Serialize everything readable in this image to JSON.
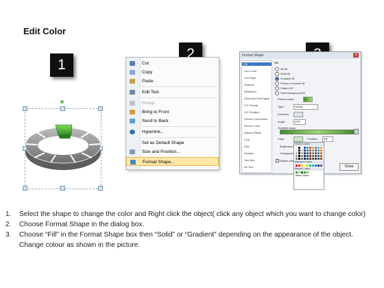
{
  "header": {
    "title": "Edit Color"
  },
  "step_badges": [
    "1",
    "2",
    "3"
  ],
  "context_menu": {
    "items": [
      {
        "label": "Cut",
        "icon": "scissors-icon",
        "disabled": false
      },
      {
        "label": "Copy",
        "icon": "copy-icon",
        "disabled": false
      },
      {
        "label": "Paste",
        "icon": "paste-icon",
        "disabled": false
      },
      {
        "label": "Edit Text",
        "icon": "edit-text-icon",
        "disabled": false
      },
      {
        "label": "Group",
        "icon": "group-icon",
        "disabled": true
      },
      {
        "label": "Bring to Front",
        "icon": "bring-to-front-icon",
        "disabled": false
      },
      {
        "label": "Send to Back",
        "icon": "send-to-back-icon",
        "disabled": false
      },
      {
        "label": "Hyperlink...",
        "icon": "hyperlink-icon",
        "disabled": false
      },
      {
        "label": "Set as Default Shape",
        "icon": "none",
        "disabled": false
      },
      {
        "label": "Size and Position...",
        "icon": "size-position-icon",
        "disabled": false
      },
      {
        "label": "Format Shape...",
        "icon": "format-shape-icon",
        "disabled": false,
        "highlighted": true
      }
    ]
  },
  "format_dialog": {
    "title": "Format Shape",
    "categories": [
      "Fill",
      "Line Color",
      "Line Style",
      "Shadow",
      "Reflection",
      "Glow and Soft Edges",
      "3-D Format",
      "3-D Rotation",
      "Picture Corrections",
      "Picture Color",
      "Artistic Effects",
      "Crop",
      "Size",
      "Position",
      "Text Box",
      "Alt Text"
    ],
    "section": "Fill",
    "fill_options": [
      "No fill",
      "Solid fill",
      "Gradient fill",
      "Picture or texture fill",
      "Pattern fill",
      "Slide background fill"
    ],
    "selected_fill": "Gradient fill",
    "preset_colors_label": "Preset colors:",
    "type_label": "Type:",
    "type_value": "Linear",
    "direction_label": "Direction:",
    "angle_label": "Angle:",
    "angle_value": "270°",
    "gradient_stops_label": "Gradient stops",
    "color_label": "Color",
    "position_label": "Position:",
    "position_value": "0%",
    "brightness_label": "Brightness:",
    "transparency_label": "Transparency:",
    "rotate_label": "Rotate with shape",
    "close_label": "Close",
    "palette": {
      "theme_header": "Theme Colors",
      "standard_header": "Standard Colors",
      "recent_header": "Recent Colors",
      "more_label": "More Colors...",
      "theme_colors": [
        "#ffffff",
        "#000000",
        "#eeece1",
        "#1f497d",
        "#4f81bd",
        "#c0504d",
        "#9bbb59",
        "#8064a2",
        "#4bacc6",
        "#f79646"
      ],
      "standard_colors": [
        "#c00000",
        "#ff0000",
        "#ffc000",
        "#ffff00",
        "#92d050",
        "#00b050",
        "#00b0f0",
        "#0070c0",
        "#002060",
        "#7030a0"
      ],
      "recent_colors": [
        "#3e8e2e",
        "#9fd86e",
        "#006600",
        "#339933",
        "#66cc33"
      ]
    }
  },
  "instructions": [
    {
      "num": "1.",
      "text": "Select the shape to change the color and Right click the object( click any object which you want to change color)"
    },
    {
      "num": "2.",
      "text": "Choose Format Shape in the dialog box."
    },
    {
      "num": "3.",
      "text": "Choose “Fill” in the Format Shape box then “Solid” or “Gradient” depending on the appearance of the object. Change colour as shown in the picture."
    }
  ],
  "colors": {
    "segment_gray": "#8c8c8c",
    "segment_highlight": "#3fae2f",
    "menu_highlight": "#ffe7a6",
    "dialog_selection": "#3b78c3"
  }
}
